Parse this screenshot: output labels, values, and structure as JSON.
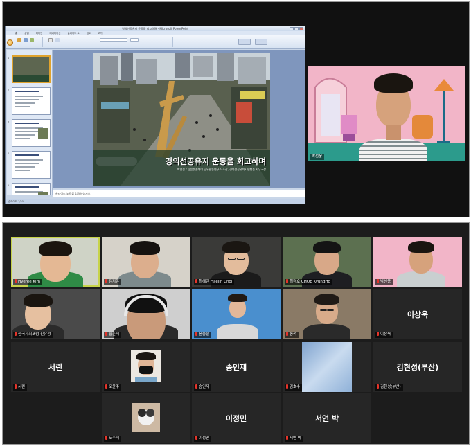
{
  "screen_share": {
    "window_title": "경의선공유지 운동을 회고하며 - Microsoft PowerPoint",
    "ribbon_tabs": [
      "홈",
      "삽입",
      "디자인",
      "애니메이션",
      "슬라이드 쇼",
      "검토",
      "보기"
    ],
    "slide_title": "경의선공유지 운동을 회고하며",
    "slide_subtitle": "박선웅 / 팀플랫폼데이 공유활동연구소 소장, 경의선공유지시민행동 사무국장",
    "notes_text": "슬라이드 노트를 입력하십시오",
    "status_text": "슬라이드 1/20",
    "slide_count": 6,
    "speaker_name": "박선웅"
  },
  "gallery": {
    "participants": [
      {
        "name": "Hyeree Kim",
        "type": "video",
        "active": true
      },
      {
        "name": "김지은",
        "type": "video"
      },
      {
        "name": "최혜린 Haejin Choi",
        "type": "video"
      },
      {
        "name": "최경호 CHOE KyungHo",
        "type": "video"
      },
      {
        "name": "박선웅",
        "type": "video"
      },
      {
        "name": "한국사회포럼 신유정",
        "type": "video"
      },
      {
        "name": "홍준서",
        "type": "video"
      },
      {
        "name": "윤승철",
        "type": "video"
      },
      {
        "name": "송석",
        "type": "video"
      },
      {
        "name": "이상욱",
        "type": "name",
        "label": "이상욱"
      },
      {
        "name": "서린",
        "type": "name",
        "label": "서린"
      },
      {
        "name": "오윤주",
        "type": "avatar"
      },
      {
        "name": "송인재",
        "type": "name",
        "label": "송인재"
      },
      {
        "name": "김호수",
        "type": "avatar-sky"
      },
      {
        "name": "김현성(부산)",
        "type": "name",
        "label": "김현성(부산)"
      },
      {
        "name": "노수지",
        "type": "avatar-cat"
      },
      {
        "name": "이정민",
        "type": "name",
        "label": "이정민"
      },
      {
        "name": "서연 박",
        "type": "name",
        "label": "서연 박"
      }
    ]
  },
  "colors": {
    "active_speaker_border": "#c7d34a",
    "mic_muted": "#e5342a",
    "gallery_bg": "#1c1c1c",
    "tile_bg": "#262626"
  },
  "icons": [
    "muted-mic-icon",
    "office-button-icon"
  ]
}
